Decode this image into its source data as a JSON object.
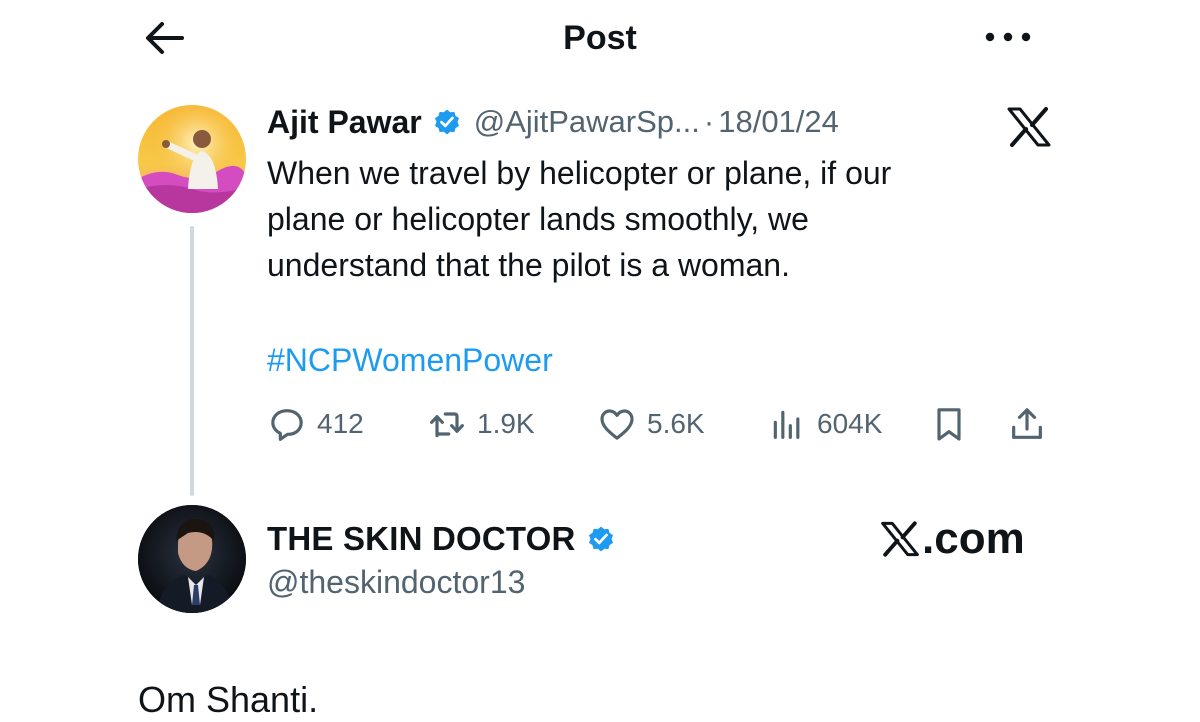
{
  "header": {
    "title": "Post",
    "back_icon": "arrow-left-icon",
    "more_icon": "more-horizontal-icon"
  },
  "post": {
    "author": {
      "display_name": "Ajit Pawar",
      "handle": "@AjitPawarSp...",
      "verified": true
    },
    "separator": "·",
    "date": "18/01/24",
    "source_icon": "x-logo-icon",
    "text_lines": [
      "When we travel by helicopter or plane, if our",
      "plane or helicopter lands smoothly, we",
      "understand that the pilot is a woman."
    ],
    "hashtag": "#NCPWomenPower",
    "actions": {
      "replies": "412",
      "reposts": "1.9K",
      "likes": "5.6K",
      "views": "604K"
    }
  },
  "reply": {
    "author": {
      "display_name": "THE SKIN DOCTOR",
      "handle": "@theskindoctor13",
      "verified": true
    },
    "text": "Om Shanti."
  },
  "watermark": {
    "text": ".com"
  },
  "colors": {
    "text": "#0f1419",
    "secondary": "#536471",
    "accent": "#1d9bf0",
    "thread_line": "#cfd9de"
  }
}
